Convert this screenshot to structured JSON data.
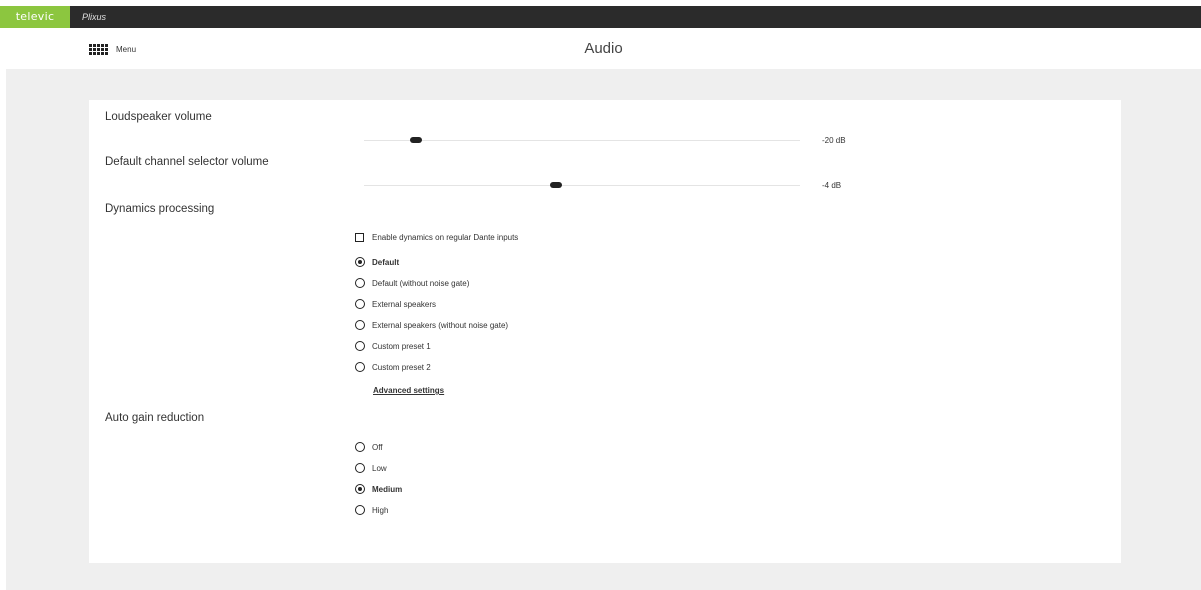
{
  "topbar": {
    "brand": "televic",
    "product": "Plixus"
  },
  "header": {
    "menu_label": "Menu",
    "title": "Audio"
  },
  "loudspeaker": {
    "label": "Loudspeaker volume",
    "value": "-20 dB",
    "slider_fraction": 0.12
  },
  "channel_selector": {
    "label": "Default channel selector volume",
    "value": "-4 dB",
    "slider_fraction": 0.44
  },
  "dynamics": {
    "label": "Dynamics processing",
    "checkbox_label": "Enable dynamics on regular Dante inputs",
    "checkbox_checked": false,
    "options": [
      {
        "label": "Default",
        "selected": true
      },
      {
        "label": "Default (without noise gate)",
        "selected": false
      },
      {
        "label": "External speakers",
        "selected": false
      },
      {
        "label": "External speakers (without noise gate)",
        "selected": false
      },
      {
        "label": "Custom preset 1",
        "selected": false
      },
      {
        "label": "Custom preset 2",
        "selected": false
      }
    ],
    "advanced_link": "Advanced settings"
  },
  "auto_gain": {
    "label": "Auto gain reduction",
    "options": [
      {
        "label": "Off",
        "selected": false
      },
      {
        "label": "Low",
        "selected": false
      },
      {
        "label": "Medium",
        "selected": true
      },
      {
        "label": "High",
        "selected": false
      }
    ]
  },
  "icons": {
    "menu": "grid-menu-icon"
  },
  "colors": {
    "brand": "#8cc63f",
    "topbar": "#2b2b2b",
    "page_bg": "#efefef"
  }
}
